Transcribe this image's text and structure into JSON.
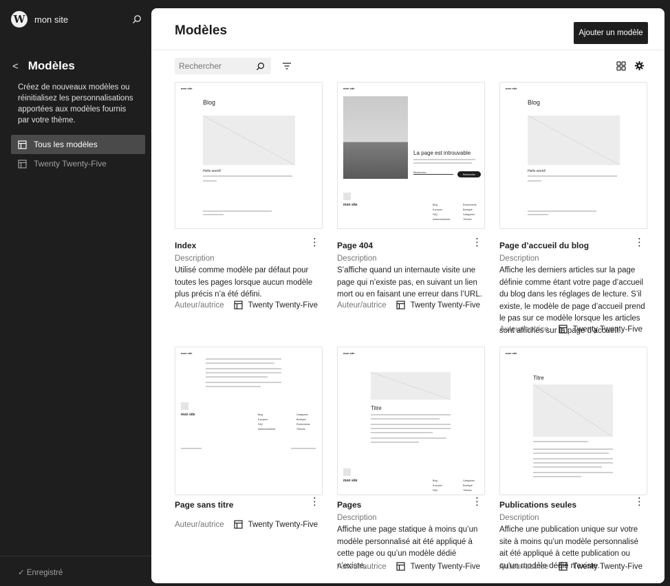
{
  "site": {
    "name": "mon site"
  },
  "sidebar": {
    "title": "Modèles",
    "description": "Créez de nouveaux modèles ou réinitialisez les personnalisations apportées aux modèles fournis par votre thème.",
    "items": [
      {
        "label": "Tous les modèles",
        "active": true
      },
      {
        "label": "Twenty Twenty-Five",
        "active": false
      }
    ],
    "footer_status": "✓ Enregistré"
  },
  "header": {
    "title": "Modèles",
    "add_button": "Ajouter un modèle"
  },
  "toolbar": {
    "search_placeholder": "Rechercher"
  },
  "labels": {
    "description": "Description",
    "author": "Auteur/autrice"
  },
  "cards": [
    {
      "name": "Index",
      "has_description": true,
      "description": "Utilisé comme modèle par défaut pour toutes les pages lorsque aucun modèle plus précis n’a été défini.",
      "author": "Twenty Twenty-Five"
    },
    {
      "name": "Page 404",
      "has_description": true,
      "description": "S’affiche quand un internaute visite une page qui n’existe pas, en suivant un lien mort ou en faisant une erreur dans l’URL.",
      "author": "Twenty Twenty-Five"
    },
    {
      "name": "Page d’accueil du blog",
      "has_description": true,
      "description": "Affiche les derniers articles sur la page définie comme étant votre page d’accueil du blog dans les réglages de lecture. S’il existe, le modèle de page d’accueil prend le pas sur ce modèle lorsque les articles sont affichés sur la page d’accueil.",
      "author": "Twenty Twenty-Five"
    },
    {
      "name": "Page sans titre",
      "has_description": false,
      "description": "",
      "author": "Twenty Twenty-Five"
    },
    {
      "name": "Pages",
      "has_description": true,
      "description": "Affiche une page statique à moins qu’un modèle personnalisé ait été appliqué à cette page ou qu’un modèle dédié n’existe.",
      "author": "Twenty Twenty-Five"
    },
    {
      "name": "Publications seules",
      "has_description": true,
      "description": "Affiche une publication unique sur votre site à moins qu’un modèle personnalisé ait été appliqué à cette publication ou qu’un modèle dédié n’existe.",
      "author": "Twenty Twenty-Five"
    }
  ],
  "previews": {
    "site_title": "mon site",
    "blog_heading": "Blog",
    "post_title": "Hello world!",
    "not_found": "La page est introuvable",
    "search_button": "Rechercher",
    "search_field": "Rechercher...",
    "page_title": "Titre",
    "footer_links": [
      "Blog",
      "À propos",
      "FAQ",
      "Auteurs/autrices",
      "Évènements",
      "Boutique",
      "Catégories",
      "Thèmes"
    ]
  },
  "colors": {
    "sidebar_bg": "#1e1e1e",
    "accent": "#1e1e1e",
    "active_item": "#4a4a4a"
  },
  "icons": {
    "logo": "wordpress-logo-icon",
    "search": "search-icon",
    "back": "chevron-left-icon",
    "template": "layout-icon",
    "filter": "funnel-icon",
    "view": "grid-view-icon",
    "settings": "gear-icon",
    "more": "more-vertical-icon"
  }
}
